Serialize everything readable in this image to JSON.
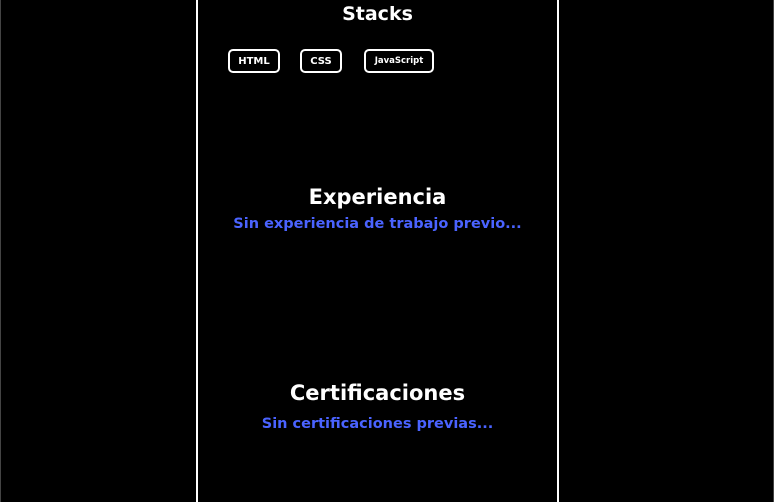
{
  "stacks": {
    "title": "Stacks",
    "items": [
      {
        "label": "HTML"
      },
      {
        "label": "CSS"
      },
      {
        "label": "JavaScript"
      }
    ]
  },
  "experience": {
    "title": "Experiencia",
    "note": "Sin experiencia de trabajo previo..."
  },
  "certifications": {
    "title": "Certificaciones",
    "note": "Sin certificaciones previas..."
  },
  "colors": {
    "background": "#000000",
    "text": "#ffffff",
    "accent": "#4a63ff"
  }
}
